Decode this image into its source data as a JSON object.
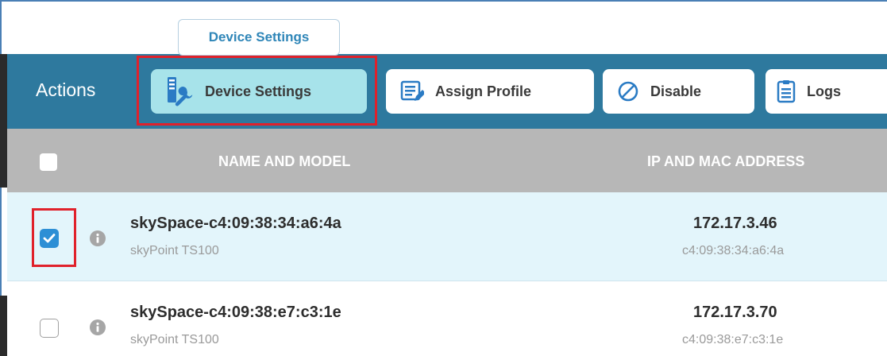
{
  "tooltip": {
    "text": "Device Settings"
  },
  "actions": {
    "label": "Actions",
    "buttons": [
      {
        "label": "Device Settings",
        "icon": "device-settings-icon",
        "active": true
      },
      {
        "label": "Assign Profile",
        "icon": "assign-profile-icon"
      },
      {
        "label": "Disable",
        "icon": "disable-icon"
      },
      {
        "label": "Logs",
        "icon": "logs-icon"
      }
    ]
  },
  "table": {
    "columns": [
      "NAME AND MODEL",
      "IP AND MAC ADDRESS"
    ],
    "rows": [
      {
        "name": "skySpace-c4:09:38:34:a6:4a",
        "model": "skyPoint TS100",
        "ip": "172.17.3.46",
        "mac": "c4:09:38:34:a6:4a",
        "selected": true
      },
      {
        "name": "skySpace-c4:09:38:e7:c3:1e",
        "model": "skyPoint TS100",
        "ip": "172.17.3.70",
        "mac": "c4:09:38:e7:c3:1e",
        "selected": false
      }
    ]
  },
  "colors": {
    "actions_bar": "#2e799e",
    "active_button": "#a7e3ea",
    "header": "#b7b7b7",
    "selected_row": "#e3f5fb",
    "checkbox_checked": "#2d8fd5",
    "highlight": "#e0212b",
    "tooltip_text": "#2f86b8"
  }
}
